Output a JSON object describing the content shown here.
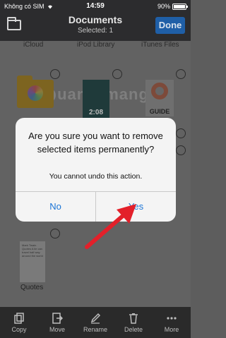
{
  "status_bar": {
    "carrier": "Không có SIM",
    "time": "14:59",
    "battery": "90%",
    "battery_level": 0.9
  },
  "nav": {
    "title": "Documents",
    "subtitle": "Selected: 1",
    "done_label": "Done"
  },
  "columns": [
    "iCloud",
    "iPod Library",
    "iTunes Files"
  ],
  "watermark": "uantrimang",
  "files": {
    "video_duration": "2:08",
    "guide_label": "GUIDE",
    "quotes_thumb_text": "Mark Twain Quotes A lie can travel half way around the world",
    "quotes_label": "Quotes"
  },
  "dialog": {
    "title": "Are you sure you want to remove selected items permanently?",
    "message": "You cannot undo this action.",
    "no_label": "No",
    "yes_label": "Yes"
  },
  "toolbar": {
    "items": [
      {
        "label": "Copy",
        "icon": "copy-icon"
      },
      {
        "label": "Move",
        "icon": "move-icon"
      },
      {
        "label": "Rename",
        "icon": "rename-icon"
      },
      {
        "label": "Delete",
        "icon": "trash-icon"
      },
      {
        "label": "More",
        "icon": "more-icon"
      }
    ]
  },
  "colors": {
    "accent": "#1a74d6",
    "arrow": "#e3202a",
    "dialog_bg": "#f4f4f4"
  }
}
